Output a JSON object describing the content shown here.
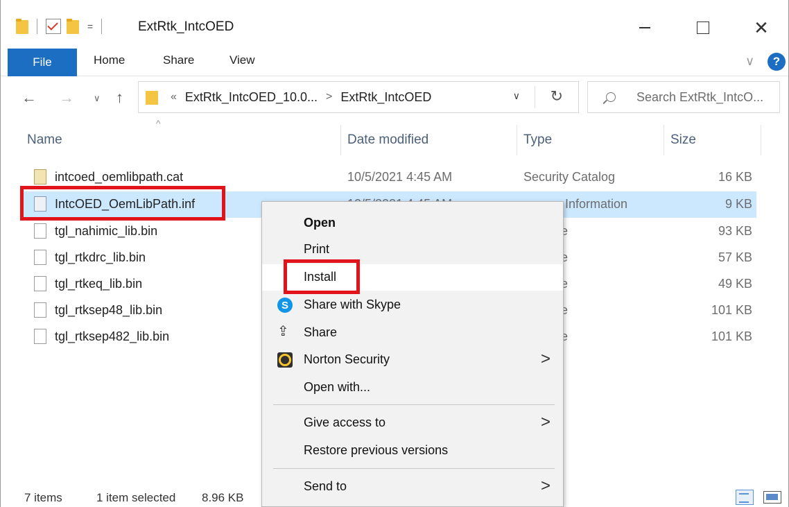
{
  "window": {
    "title": "ExtRtk_IntcOED",
    "qat_dropdown": "=",
    "close_glyph": "✕"
  },
  "ribbon": {
    "tabs": [
      "File",
      "Home",
      "Share",
      "View"
    ],
    "help_glyph": "?",
    "collapse_glyph": "∨",
    "accent_color": "#1b6ec2"
  },
  "nav": {
    "back": "←",
    "forward": "→",
    "recent": "∨",
    "up": "↑",
    "refresh": "↻",
    "dropdown": "∨"
  },
  "address": {
    "overflow": "«",
    "crumbs": [
      "ExtRtk_IntcOED_10.0...",
      "ExtRtk_IntcOED"
    ],
    "sep": ">"
  },
  "search": {
    "placeholder": "Search ExtRtk_IntcO..."
  },
  "columns": {
    "name": "Name",
    "date": "Date modified",
    "type": "Type",
    "size": "Size",
    "sort_glyph": "^"
  },
  "files": [
    {
      "name": "intcoed_oemlibpath.cat",
      "date": "10/5/2021 4:45 AM",
      "type": "Security Catalog",
      "size": "16 KB",
      "icon": "catalog-file-icon"
    },
    {
      "name": "IntcOED_OemLibPath.inf",
      "date": "10/5/2021 4:45 AM",
      "type": "Setup Information",
      "size": "9 KB",
      "icon": "inf-file-icon",
      "selected": true
    },
    {
      "name": "tgl_nahimic_lib.bin",
      "date": "",
      "type": "BIN File",
      "size": "93 KB",
      "icon": "generic-file-icon"
    },
    {
      "name": "tgl_rtkdrc_lib.bin",
      "date": "",
      "type": "BIN File",
      "size": "57 KB",
      "icon": "generic-file-icon"
    },
    {
      "name": "tgl_rtkeq_lib.bin",
      "date": "",
      "type": "BIN File",
      "size": "49 KB",
      "icon": "generic-file-icon"
    },
    {
      "name": "tgl_rtksep48_lib.bin",
      "date": "",
      "type": "BIN File",
      "size": "101 KB",
      "icon": "generic-file-icon"
    },
    {
      "name": "tgl_rtksep482_lib.bin",
      "date": "",
      "type": "BIN File",
      "size": "101 KB",
      "icon": "generic-file-icon"
    }
  ],
  "visible_type_fragments": {
    "selected": "Information",
    "bin": "le"
  },
  "context_menu": {
    "open": "Open",
    "print": "Print",
    "install": "Install",
    "share_skype": "Share with Skype",
    "share": "Share",
    "norton": "Norton Security",
    "open_with": "Open with...",
    "give_access": "Give access to",
    "restore": "Restore previous versions",
    "send_to": "Send to",
    "submenu_arrow": ">",
    "skype_glyph": "S",
    "share_glyph": "⇪"
  },
  "status": {
    "count": "7 items",
    "selected": "1 item selected",
    "size": "8.96 KB"
  },
  "colors": {
    "selection": "#cce8ff",
    "highlight_box": "#e3131c",
    "menu_bg": "#f2f2f2"
  }
}
